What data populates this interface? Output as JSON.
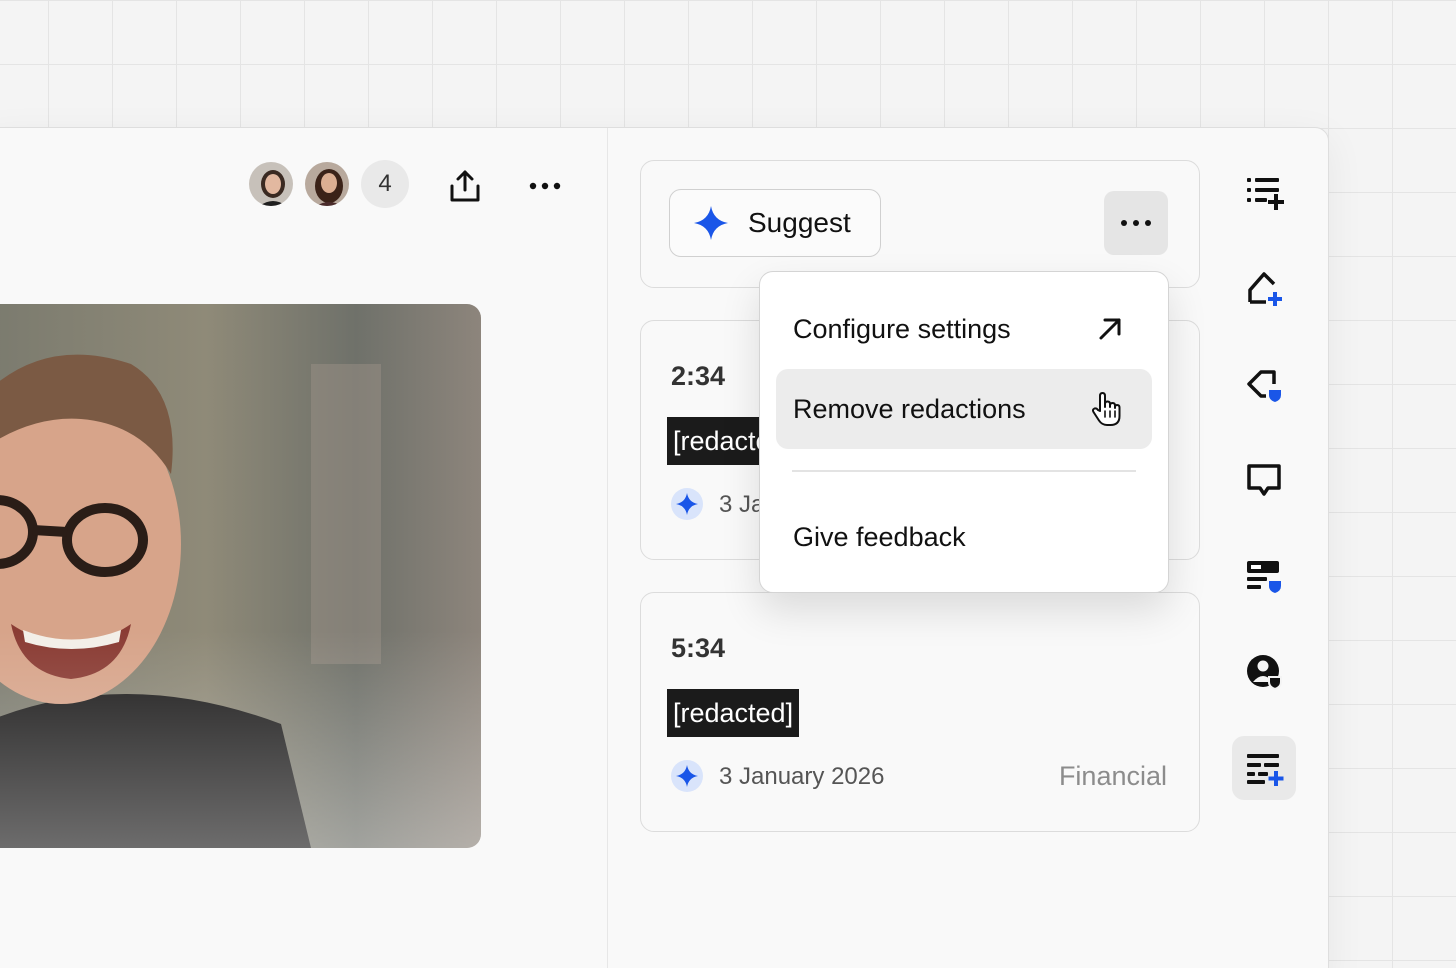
{
  "header": {
    "participant_count": "4",
    "share_icon": "share-icon",
    "more_icon": "more-horizontal-icon"
  },
  "panel": {
    "suggest_label": "Suggest",
    "more_icon": "more-horizontal-icon"
  },
  "menu": {
    "items": [
      {
        "label": "Configure settings",
        "icon": "arrow-up-right-icon"
      },
      {
        "label": "Remove redactions",
        "icon": "hand-pointer-icon",
        "hovered": true
      },
      {
        "label": "Give feedback"
      }
    ]
  },
  "redactions": [
    {
      "time": "2:34",
      "text": "[redacted]",
      "date": "3 January 2026",
      "category": ""
    },
    {
      "time": "5:34",
      "text": "[redacted]",
      "date": "3 January 2026",
      "category": "Financial"
    }
  ],
  "sidebar_icons": [
    "list-add-icon",
    "tag-add-icon",
    "tag-shield-icon",
    "comment-icon",
    "form-shield-icon",
    "user-shield-icon",
    "redaction-list-add-icon"
  ],
  "colors": {
    "accent": "#1a56e8",
    "redaction_bg": "#1b1b1b",
    "hover_bg": "#ececec"
  }
}
